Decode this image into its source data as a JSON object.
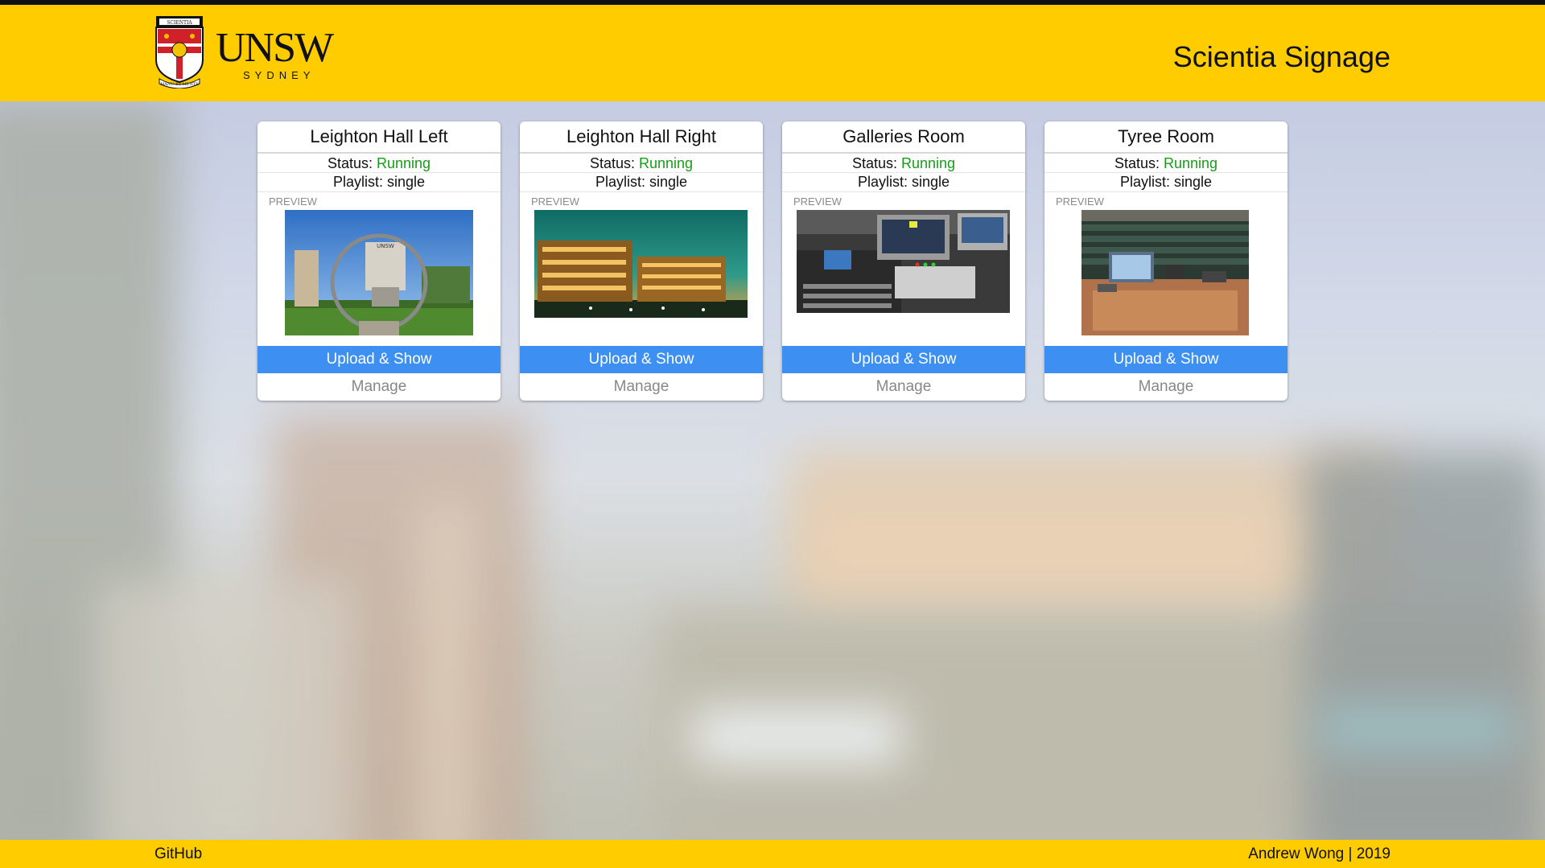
{
  "header": {
    "logo_wordmark": "UNSW",
    "logo_sub": "SYDNEY",
    "logo_motto": "MANU ET MENTE",
    "logo_scroll": "SCIENTIA",
    "title": "Scientia Signage"
  },
  "cards": [
    {
      "name": "Leighton Hall Left",
      "status_label": "Status:",
      "status_value": "Running",
      "playlist": "Playlist: single",
      "preview_label": "PREVIEW",
      "upload_label": "Upload & Show",
      "manage_label": "Manage",
      "thumb_icon": "unsw-campus-photo"
    },
    {
      "name": "Leighton Hall Right",
      "status_label": "Status:",
      "status_value": "Running",
      "playlist": "Playlist: single",
      "preview_label": "PREVIEW",
      "upload_label": "Upload & Show",
      "manage_label": "Manage",
      "thumb_icon": "building-night-photo"
    },
    {
      "name": "Galleries Room",
      "status_label": "Status:",
      "status_value": "Running",
      "playlist": "Playlist: single",
      "preview_label": "PREVIEW",
      "upload_label": "Upload & Show",
      "manage_label": "Manage",
      "thumb_icon": "av-equipment-photo"
    },
    {
      "name": "Tyree Room",
      "status_label": "Status:",
      "status_value": "Running",
      "playlist": "Playlist: single",
      "preview_label": "PREVIEW",
      "upload_label": "Upload & Show",
      "manage_label": "Manage",
      "thumb_icon": "lecture-theatre-photo"
    }
  ],
  "footer": {
    "github": "GitHub",
    "credit": "Andrew Wong | 2019"
  },
  "colors": {
    "brand_yellow": "#ffcc00",
    "button_blue": "#3d8ff2",
    "status_green": "#1a9a1a"
  }
}
